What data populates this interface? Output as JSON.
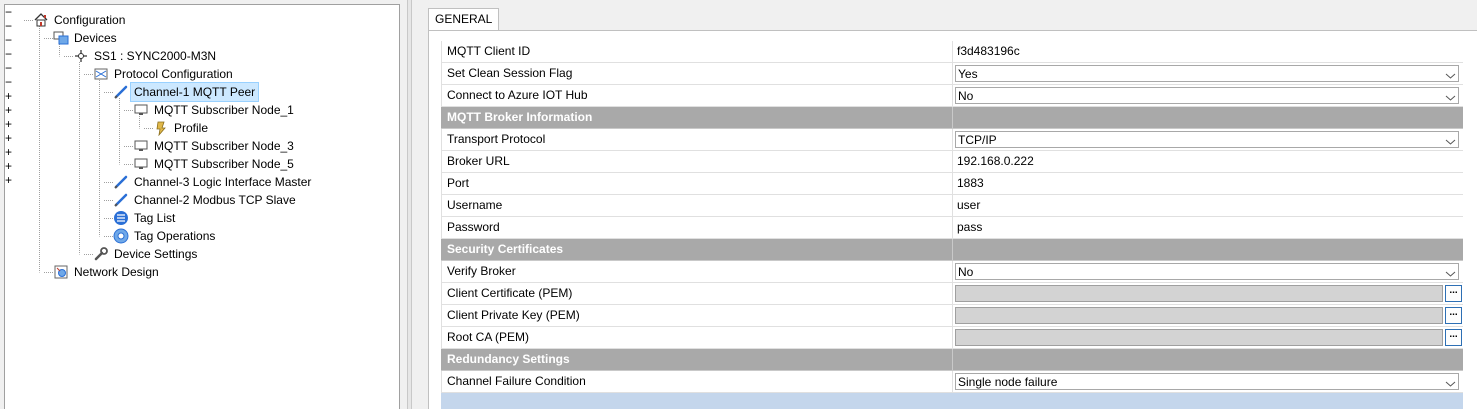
{
  "tree": {
    "nodes": [
      {
        "id": "configuration",
        "label": "Configuration",
        "icon": "home-icon",
        "expander": "minus"
      },
      {
        "id": "devices",
        "label": "Devices",
        "icon": "devices-icon",
        "expander": "minus"
      },
      {
        "id": "ss1",
        "label": "SS1 : SYNC2000-M3N",
        "icon": "device-node-icon",
        "expander": "minus"
      },
      {
        "id": "protocol-configuration",
        "label": "Protocol Configuration",
        "icon": "protocol-icon",
        "expander": "minus"
      },
      {
        "id": "channel-1",
        "label": "Channel-1 MQTT Peer",
        "icon": "channel-icon",
        "expander": "minus"
      },
      {
        "id": "mqtt-node-1",
        "label": "MQTT Subscriber Node_1",
        "icon": "monitor-icon",
        "expander": "minus"
      },
      {
        "id": "profile",
        "label": "Profile",
        "icon": "profile-icon",
        "expander": "none"
      },
      {
        "id": "mqtt-node-3",
        "label": "MQTT Subscriber Node_3",
        "icon": "monitor-icon",
        "expander": "plus"
      },
      {
        "id": "mqtt-node-5",
        "label": "MQTT Subscriber Node_5",
        "icon": "monitor-icon",
        "expander": "plus"
      },
      {
        "id": "channel-3",
        "label": "Channel-3 Logic Interface Master",
        "icon": "channel-icon",
        "expander": "plus"
      },
      {
        "id": "channel-2",
        "label": "Channel-2 Modbus TCP Slave",
        "icon": "channel-icon",
        "expander": "plus"
      },
      {
        "id": "tag-list",
        "label": "Tag List",
        "icon": "tag-list-icon",
        "expander": "plus"
      },
      {
        "id": "tag-operations",
        "label": "Tag Operations",
        "icon": "tag-operations-icon",
        "expander": "plus"
      },
      {
        "id": "device-settings",
        "label": "Device Settings",
        "icon": "wrench-icon",
        "expander": "plus"
      },
      {
        "id": "network-design",
        "label": "Network Design",
        "icon": "network-icon",
        "expander": "none"
      }
    ],
    "selected": "channel-1"
  },
  "tabs": [
    {
      "label": "GENERAL"
    }
  ],
  "properties": [
    {
      "type": "prop",
      "name": "MQTT Client ID",
      "value": "f3d483196c",
      "editor": "text"
    },
    {
      "type": "prop",
      "name": "Set Clean Session Flag",
      "value": "Yes",
      "editor": "dropdown"
    },
    {
      "type": "prop",
      "name": "Connect to Azure IOT Hub",
      "value": "No",
      "editor": "dropdown"
    },
    {
      "type": "category",
      "name": "MQTT Broker Information"
    },
    {
      "type": "prop",
      "name": "Transport Protocol",
      "value": "TCP/IP",
      "editor": "dropdown"
    },
    {
      "type": "prop",
      "name": "Broker URL",
      "value": "192.168.0.222",
      "editor": "text"
    },
    {
      "type": "prop",
      "name": "Port",
      "value": "1883",
      "editor": "text"
    },
    {
      "type": "prop",
      "name": "Username",
      "value": "user",
      "editor": "text"
    },
    {
      "type": "prop",
      "name": "Password",
      "value": "pass",
      "editor": "text"
    },
    {
      "type": "category",
      "name": "Security Certificates"
    },
    {
      "type": "prop",
      "name": "Verify Broker",
      "value": "No",
      "editor": "dropdown"
    },
    {
      "type": "prop",
      "name": "Client Certificate (PEM)",
      "value": "",
      "editor": "file"
    },
    {
      "type": "prop",
      "name": "Client Private Key (PEM)",
      "value": "",
      "editor": "file"
    },
    {
      "type": "prop",
      "name": "Root CA (PEM)",
      "value": "",
      "editor": "file"
    },
    {
      "type": "category",
      "name": "Redundancy Settings"
    },
    {
      "type": "prop",
      "name": "Channel Failure Condition",
      "value": "Single node failure",
      "editor": "dropdown"
    }
  ],
  "browse_label": "...",
  "colors": {
    "category_bg": "#a9a9a9",
    "selection_bg": "#cce8ff",
    "tree_line": "#a0a0a0",
    "icon_blue": "#2a6fd6",
    "footer_blue": "#c4d6ec"
  }
}
